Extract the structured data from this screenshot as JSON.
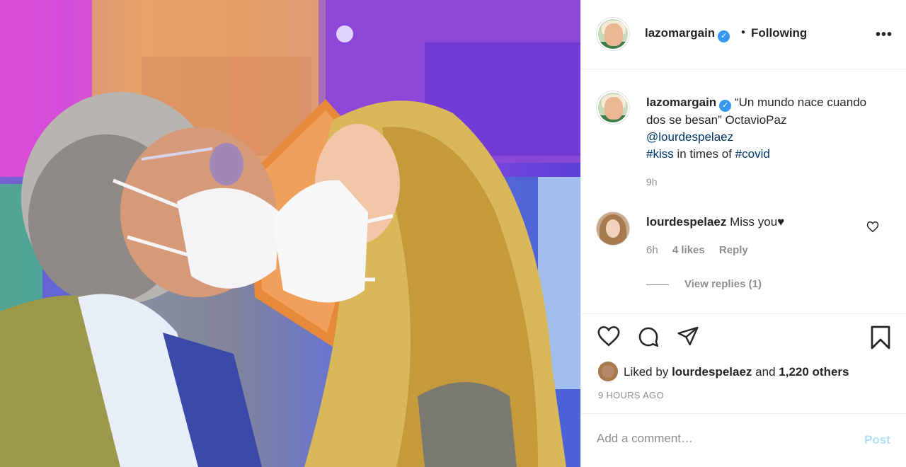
{
  "header": {
    "username": "lazomargain",
    "separator": "•",
    "follow_label": "Following",
    "more_icon": "more-dots-icon"
  },
  "caption": {
    "username": "lazomargain",
    "text": "“Un mundo nace cuando dos se besan” OctavioPaz",
    "mention": "@lourdespelaez",
    "hashtag1": "#kiss",
    "middle": " in times of ",
    "hashtag2": "#covid",
    "time": "9h"
  },
  "comment": {
    "username": "lourdespelaez",
    "text": "Miss you♥",
    "time": "6h",
    "likes": "4 likes",
    "reply_label": "Reply",
    "view_replies": "View replies (1)"
  },
  "actions": {
    "liked_by_prefix": "Liked by",
    "liked_by_user": "lourdespelaez",
    "and": "and",
    "others": "1,220 others",
    "posted_ago": "9 HOURS AGO"
  },
  "add_comment": {
    "placeholder": "Add a comment…",
    "post_label": "Post"
  },
  "colors": {
    "link": "#00376b",
    "verified": "#3897f0",
    "post_disabled": "#b2dffc"
  }
}
